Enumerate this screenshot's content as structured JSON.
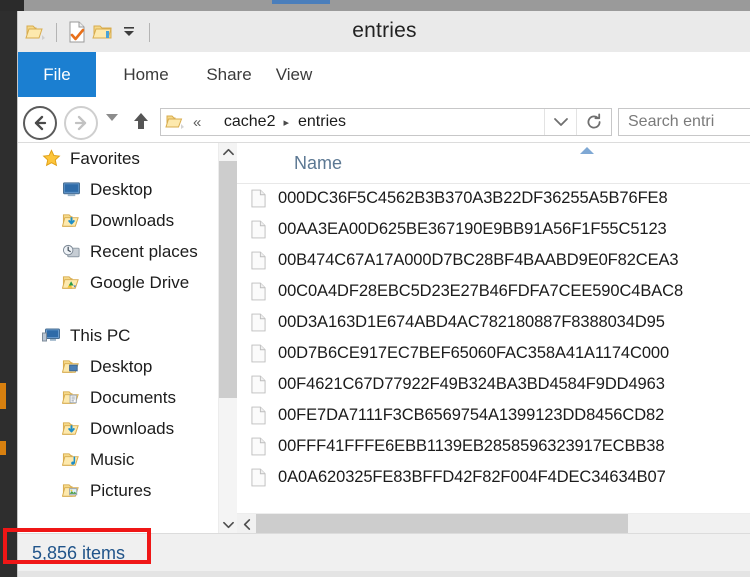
{
  "window": {
    "title": "entries"
  },
  "quick_access": {
    "system_menu_icon": "folder-icon",
    "new_item_icon": "new-document-check-icon",
    "properties_icon": "folder-properties-icon",
    "customize_icon": "chevron-down-icon"
  },
  "ribbon": {
    "tabs": [
      {
        "label": "File",
        "active": true
      },
      {
        "label": "Home",
        "active": false
      },
      {
        "label": "Share",
        "active": false
      },
      {
        "label": "View",
        "active": false
      }
    ]
  },
  "addressbar": {
    "back_icon": "arrow-left-circle-icon",
    "forward_icon": "arrow-right-circle-icon",
    "history_icon": "chevron-down-icon",
    "up_icon": "arrow-up-icon",
    "folder_icon": "folder-icon",
    "overflow": "«",
    "crumbs": [
      {
        "label": "cache2"
      },
      {
        "label": "entries"
      }
    ],
    "separator": "▸",
    "dropdown_icon": "chevron-down-icon",
    "refresh_icon": "refresh-icon"
  },
  "search": {
    "placeholder": "Search entri"
  },
  "sidebar": {
    "groups": [
      {
        "name": "Favorites",
        "icon": "star-icon",
        "items": [
          {
            "label": "Desktop",
            "icon": "monitor-icon"
          },
          {
            "label": "Downloads",
            "icon": "folder-download-icon"
          },
          {
            "label": "Recent places",
            "icon": "recent-places-icon"
          },
          {
            "label": "Google Drive",
            "icon": "folder-google-drive-icon"
          }
        ]
      },
      {
        "name": "This PC",
        "icon": "computer-icon",
        "items": [
          {
            "label": "Desktop",
            "icon": "folder-desktop-icon"
          },
          {
            "label": "Documents",
            "icon": "folder-documents-icon"
          },
          {
            "label": "Downloads",
            "icon": "folder-download-icon"
          },
          {
            "label": "Music",
            "icon": "folder-music-icon"
          },
          {
            "label": "Pictures",
            "icon": "folder-pictures-icon"
          }
        ]
      }
    ],
    "scroll": {
      "up_icon": "chevron-up-icon",
      "down_icon": "chevron-down-icon"
    }
  },
  "filelist": {
    "columns": [
      {
        "label": "Name",
        "sort": "ascending"
      }
    ],
    "sort_indicator_icon": "triangle-up-icon",
    "file_icon": "blank-file-icon",
    "rows": [
      {
        "name": "000DC36F5C4562B3B370A3B22DF36255A5B76FE8"
      },
      {
        "name": "00AA3EA00D625BE367190E9BB91A56F1F55C5123"
      },
      {
        "name": "00B474C67A17A000D7BC28BF4BAABD9E0F82CEA3"
      },
      {
        "name": "00C0A4DF28EBC5D23E27B46FDFA7CEE590C4BAC8"
      },
      {
        "name": "00D3A163D1E674ABD4AC782180887F8388034D95"
      },
      {
        "name": "00D7B6CE917EC7BEF65060FAC358A41A1174C000"
      },
      {
        "name": "00F4621C67D77922F49B324BA3BD4584F9DD4963"
      },
      {
        "name": "00FE7DA7111F3CB6569754A1399123DD8456CD82"
      },
      {
        "name": "00FFF41FFFE6EBB1139EB2858596323917ECBB38"
      },
      {
        "name": "0A0A620325FE83BFFD42F82F004F4DEC34634B07"
      }
    ],
    "hscroll": {
      "left_icon": "chevron-left-icon"
    }
  },
  "statusbar": {
    "item_count": "5,856 items"
  },
  "annotation": {
    "highlight_color": "#ef1616",
    "target": "item-count"
  },
  "colors": {
    "accent_blue": "#1b7fd1",
    "header_text": "#5c7893",
    "status_text": "#20548a",
    "folder_yellow": "#ffd470",
    "annotation_red": "#ef1616"
  }
}
